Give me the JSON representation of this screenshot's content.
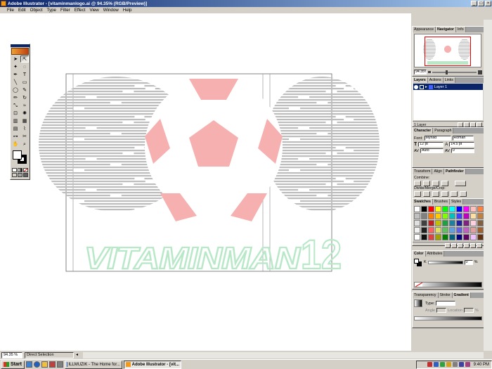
{
  "window": {
    "title": "Adobe Illustrator - [vitaminmanlogo.ai @ 94.35% (RGB/Preview)]",
    "minimize_glyph": "_",
    "maximize_glyph": "□",
    "close_glyph": "×"
  },
  "menu": [
    "File",
    "Edit",
    "Object",
    "Type",
    "Filter",
    "Effect",
    "View",
    "Window",
    "Help"
  ],
  "artwork": {
    "logo_text": "VITAMINMAN",
    "logo_number": "12",
    "ball_color": "#f7b0b0",
    "logo_color": "#b8e8c8",
    "stripe_color": "#bdbdbd"
  },
  "panels": {
    "navigator": {
      "tabs": [
        "Appearance",
        "Navigator",
        "Info"
      ],
      "zoom": "94.35%"
    },
    "layers": {
      "tabs": [
        "Layers",
        "Actions",
        "Links"
      ],
      "layer_name": "Layer 1",
      "count": "1 Layer"
    },
    "character": {
      "tabs": [
        "Character",
        "Paragraph"
      ],
      "font_label": "Font:",
      "font": "Myriad",
      "style": "Roman",
      "size": "12 pt",
      "leading": "14.5 pt",
      "tracking": "Auto",
      "kerning": "0"
    },
    "pathfinder": {
      "tabs": [
        "Transform",
        "Align",
        "Pathfinder"
      ],
      "combine_label": "Combine:",
      "divide_label": "Divide/Merge/Crop:"
    },
    "swatches": {
      "tabs": [
        "Swatches",
        "Brushes",
        "Styles"
      ],
      "colors": [
        "#ffffff",
        "#000000",
        "#ff0000",
        "#ffff00",
        "#00ff00",
        "#00ffff",
        "#0000ff",
        "#ff00ff",
        "#ffc0c0",
        "#ff8040",
        "#c0c0c0",
        "#808080",
        "#ff8000",
        "#ffcc00",
        "#80ff00",
        "#00c0c0",
        "#4040ff",
        "#c000c0",
        "#ffe0a0",
        "#c08040",
        "#e0e0e0",
        "#404040",
        "#c02020",
        "#c0c000",
        "#20a040",
        "#2080a0",
        "#2020a0",
        "#802080",
        "#ffd0e0",
        "#806040",
        "#f0f0f0",
        "#202020",
        "#ff6060",
        "#e0e060",
        "#60c060",
        "#60a0e0",
        "#6060e0",
        "#c060c0",
        "#e0a0a0",
        "#a06030",
        "#ffffff",
        "#101010",
        "#e04040",
        "#a0a000",
        "#008000",
        "#006080",
        "#000080",
        "#600060",
        "#f0c0ff",
        "#603010"
      ]
    },
    "color": {
      "tabs": [
        "Color",
        "Attributes"
      ],
      "channel": "K",
      "value": "0",
      "unit": "%"
    },
    "gradient": {
      "tabs": [
        "Transparency",
        "Stroke",
        "Gradient"
      ],
      "type_label": "Type:",
      "angle_label": "Angle",
      "location_label": "Location",
      "percent": "%"
    }
  },
  "status": {
    "zoom": "94.35 %",
    "tool": "Direct Selection"
  },
  "taskbar": {
    "start": "Start",
    "items": [
      {
        "label": "ILLMUZIK - The Home for...",
        "active": false
      },
      {
        "label": "Adobe Illustrator - [vit...",
        "active": true
      }
    ],
    "clock": "9:40 PM"
  }
}
